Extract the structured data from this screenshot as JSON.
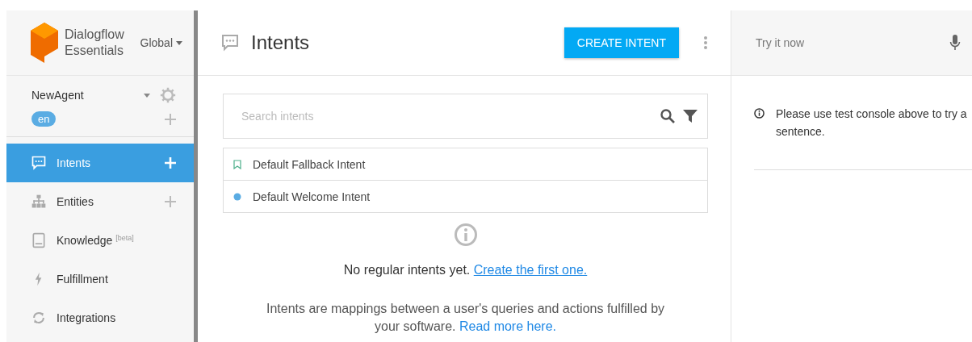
{
  "brand": {
    "line1": "Dialogflow",
    "line2": "Essentials",
    "region": "Global"
  },
  "agent": {
    "name": "NewAgent",
    "language": "en"
  },
  "sidebar": {
    "items": [
      {
        "label": "Intents",
        "selected": true,
        "add": true
      },
      {
        "label": "Entities",
        "selected": false,
        "add": true
      },
      {
        "label": "Knowledge",
        "badge": "[beta]",
        "selected": false,
        "add": false
      },
      {
        "label": "Fulfillment",
        "selected": false,
        "add": false
      },
      {
        "label": "Integrations",
        "selected": false,
        "add": false
      }
    ]
  },
  "header": {
    "title": "Intents",
    "button": "CREATE INTENT"
  },
  "search": {
    "placeholder": "Search intents"
  },
  "intents": [
    {
      "name": "Default Fallback Intent",
      "kind": "fallback"
    },
    {
      "name": "Default Welcome Intent",
      "kind": "welcome"
    }
  ],
  "empty": {
    "message": "No regular intents yet.",
    "link": "Create the first one.",
    "description": "Intents are mappings between a user's queries and actions fulfilled by your software.",
    "description_link": "Read more here."
  },
  "console": {
    "placeholder": "Try it now",
    "notice": "Please use test console above to try a sentence."
  }
}
